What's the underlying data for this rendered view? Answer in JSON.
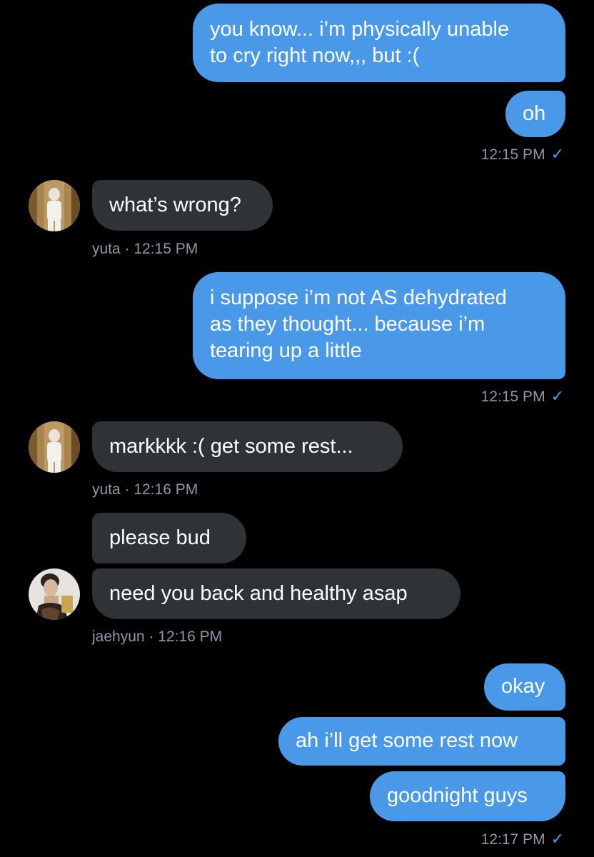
{
  "colors": {
    "background": "#000000",
    "outgoing_bubble": "#4a99e9",
    "incoming_bubble": "#2f3336",
    "meta_text": "#8b98a5",
    "read_check": "#4a99e9"
  },
  "messages": {
    "m1": "you know... i’m physically unable",
    "m1b": "to cry right now,,, but :(",
    "m2": "oh",
    "t1": "12:15 PM",
    "m3": "what’s wrong?",
    "meta3": "yuta · 12:15 PM",
    "m4a": "i suppose i’m not AS dehydrated",
    "m4b": "as they thought... because i’m",
    "m4c": "tearing up a little",
    "t2": "12:15 PM",
    "m5": "markkkk :( get some rest...",
    "meta5": "yuta · 12:16 PM",
    "m6": "please bud",
    "m7": "need you back and healthy asap",
    "meta7": "jaehyun · 12:16 PM",
    "m8": "okay",
    "m9": "ah i’ll get some rest now",
    "m10": "goodnight guys",
    "t3": "12:17 PM"
  },
  "icons": {
    "read_receipt": "checkmark-icon",
    "avatar_yuta": "avatar-yuta",
    "avatar_jaehyun": "avatar-jaehyun"
  }
}
